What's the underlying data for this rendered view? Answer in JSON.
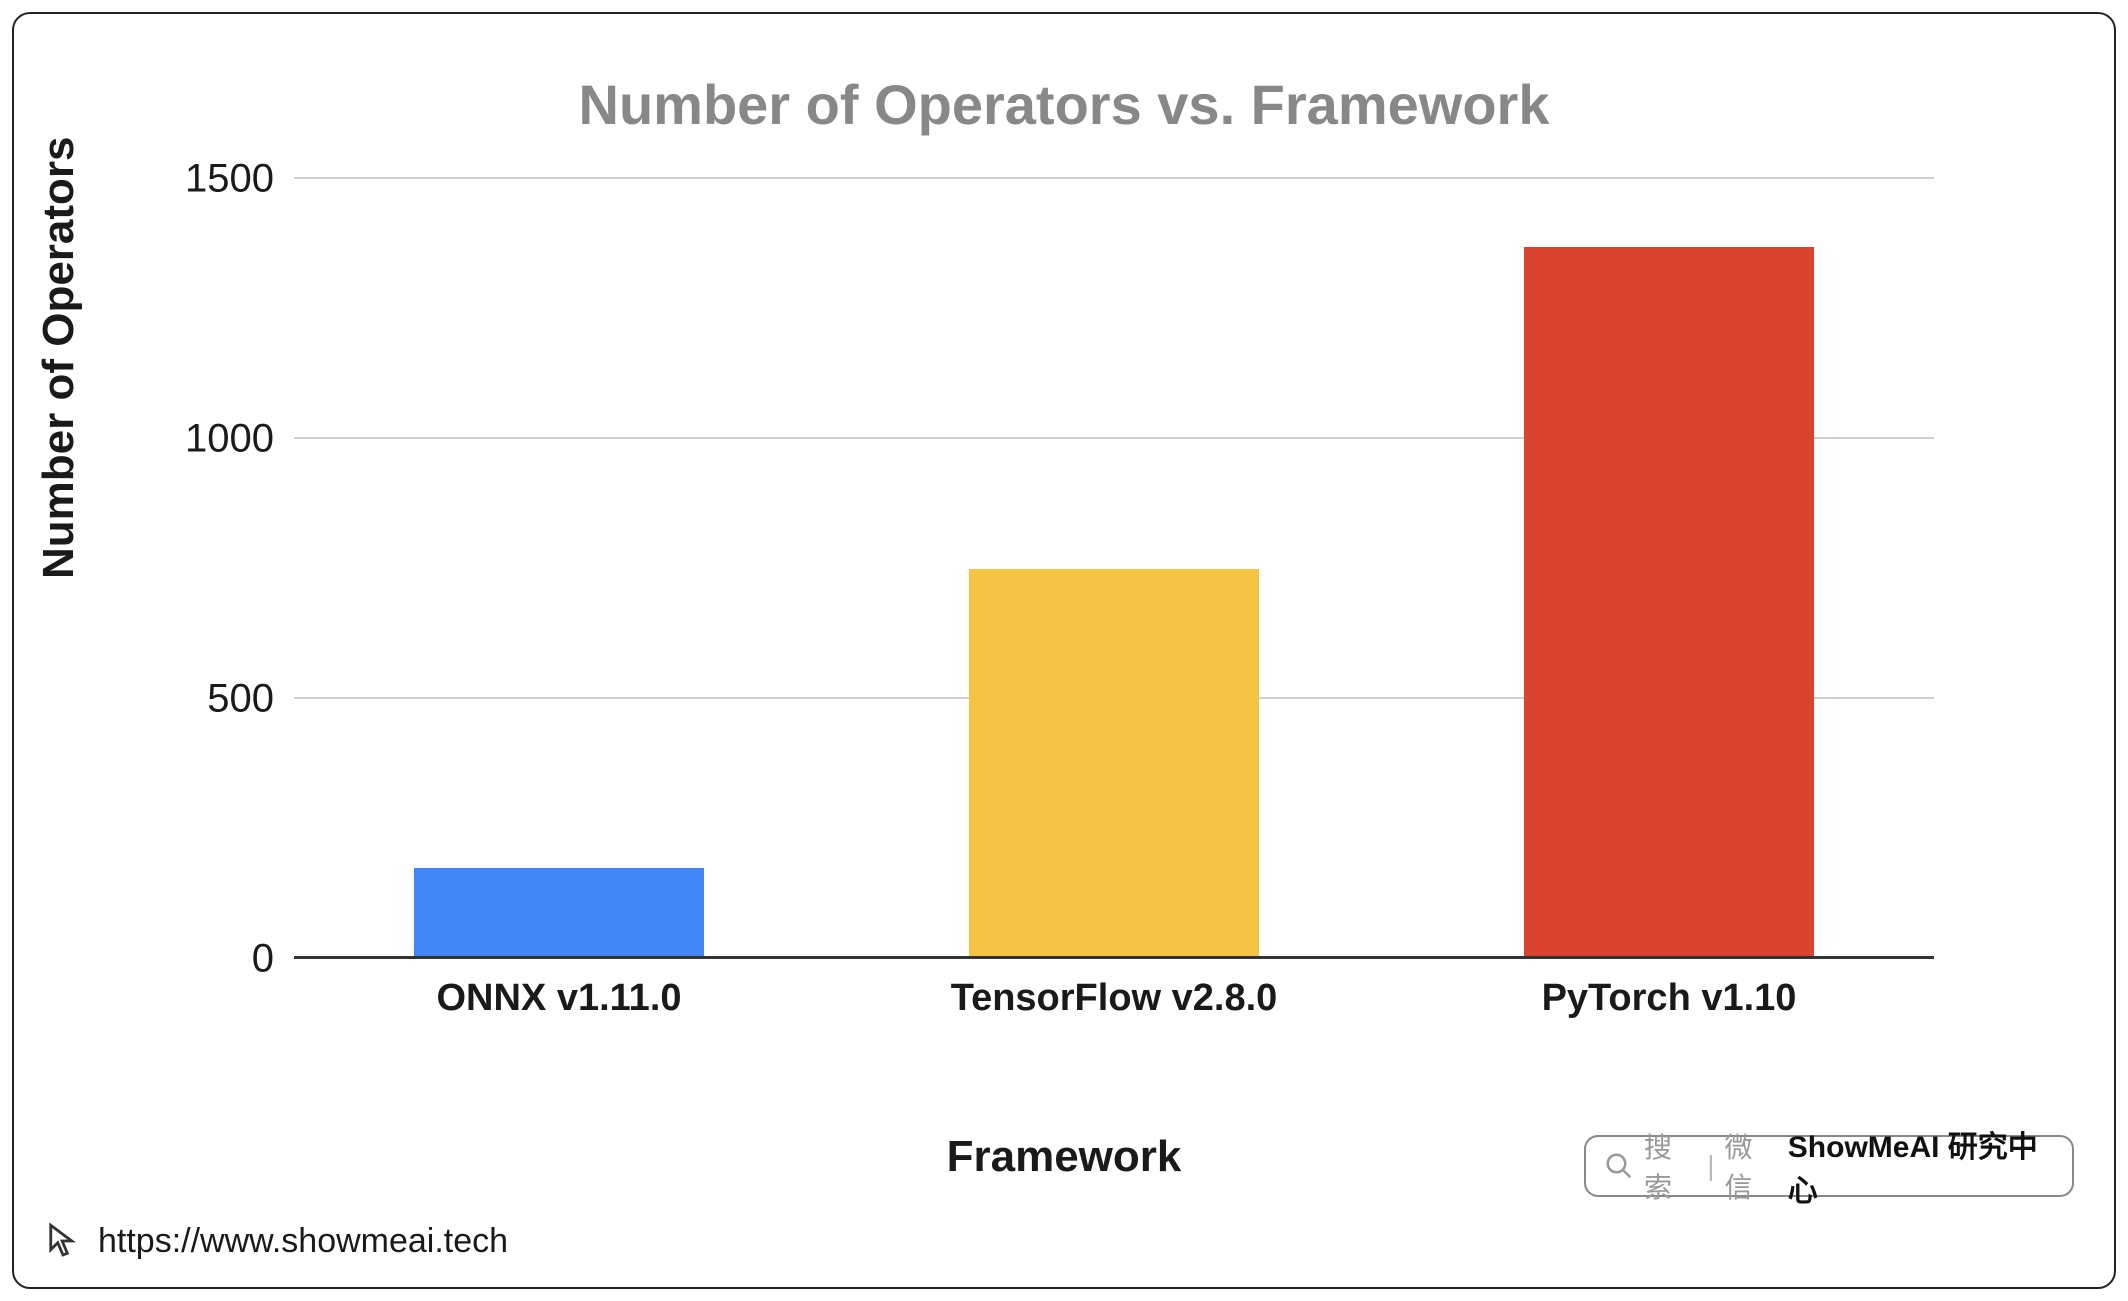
{
  "chart_data": {
    "type": "bar",
    "title": "Number of Operators vs. Framework",
    "xlabel": "Framework",
    "ylabel": "Number of Operators",
    "ylim": [
      0,
      1500
    ],
    "yticks": [
      0,
      500,
      1000,
      1500
    ],
    "categories": [
      "ONNX v1.11.0",
      "TensorFlow v2.8.0",
      "PyTorch v1.10"
    ],
    "values": [
      175,
      750,
      1370
    ],
    "colors": [
      "#4285f4",
      "#f6c444",
      "#d9432f"
    ]
  },
  "search": {
    "label": "搜索",
    "provider": "微信",
    "brand": "ShowMeAI 研究中心"
  },
  "footer": {
    "url": "https://www.showmeai.tech"
  }
}
